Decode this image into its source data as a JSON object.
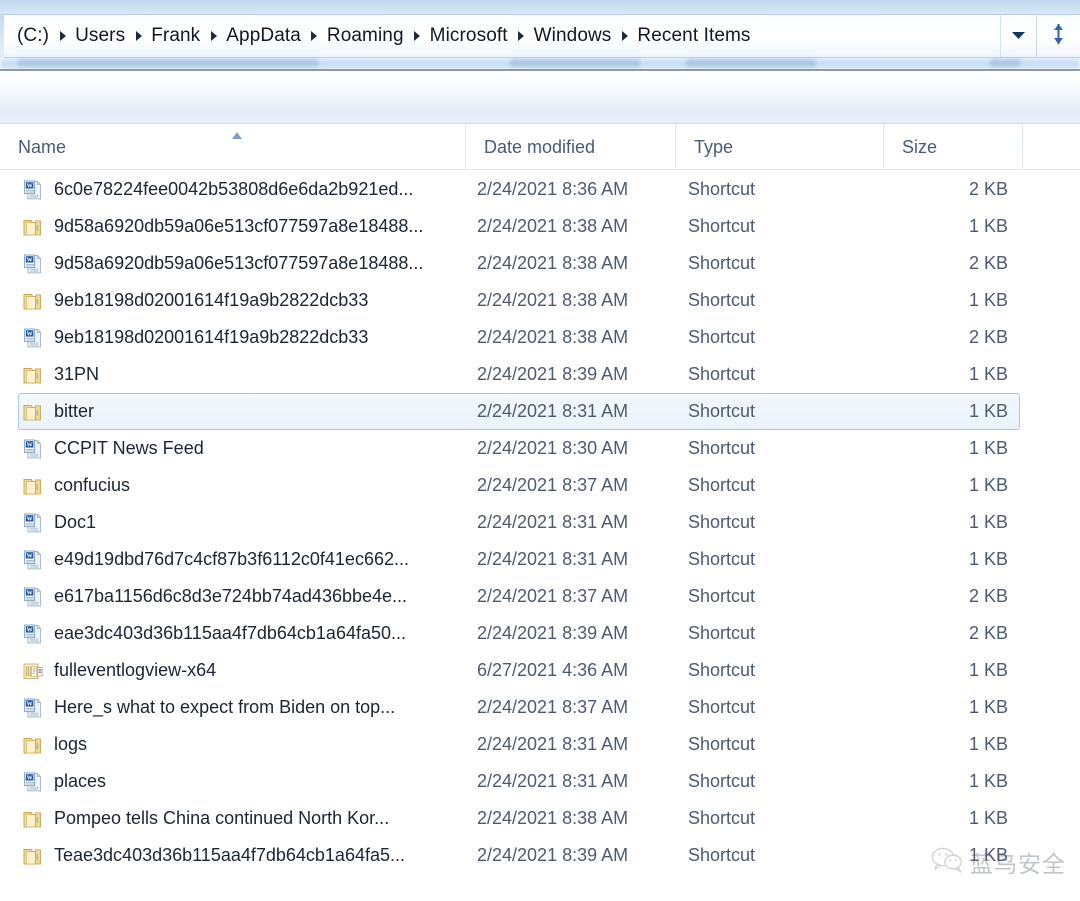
{
  "window": {
    "title": "Recent Items"
  },
  "address_bar": {
    "crumbs": [
      "(C:)",
      "Users",
      "Frank",
      "AppData",
      "Roaming",
      "Microsoft",
      "Windows",
      "Recent Items"
    ],
    "dropdown_icon": "chevron-down-icon",
    "refresh_icon": "refresh-icon",
    "refresh_color": "#1f5fa8"
  },
  "columns": {
    "name": "Name",
    "date_modified": "Date modified",
    "type": "Type",
    "size": "Size",
    "sort_column": "Name",
    "sort_direction": "ascending"
  },
  "files": [
    {
      "name": "6c0e78224fee0042b53808d6e6da2b921ed...",
      "icon": "word-document-icon",
      "date": "2/24/2021 8:36 AM",
      "type": "Shortcut",
      "size": "2 KB",
      "selected": false
    },
    {
      "name": "9d58a6920db59a06e513cf077597a8e18488...",
      "icon": "folder-icon",
      "date": "2/24/2021 8:38 AM",
      "type": "Shortcut",
      "size": "1 KB",
      "selected": false
    },
    {
      "name": "9d58a6920db59a06e513cf077597a8e18488...",
      "icon": "word-document-icon",
      "date": "2/24/2021 8:38 AM",
      "type": "Shortcut",
      "size": "2 KB",
      "selected": false
    },
    {
      "name": "9eb18198d02001614f19a9b2822dcb33",
      "icon": "folder-icon",
      "date": "2/24/2021 8:38 AM",
      "type": "Shortcut",
      "size": "1 KB",
      "selected": false
    },
    {
      "name": "9eb18198d02001614f19a9b2822dcb33",
      "icon": "word-document-icon",
      "date": "2/24/2021 8:38 AM",
      "type": "Shortcut",
      "size": "2 KB",
      "selected": false
    },
    {
      "name": "31PN",
      "icon": "folder-icon",
      "date": "2/24/2021 8:39 AM",
      "type": "Shortcut",
      "size": "1 KB",
      "selected": false
    },
    {
      "name": "bitter",
      "icon": "folder-icon",
      "date": "2/24/2021 8:31 AM",
      "type": "Shortcut",
      "size": "1 KB",
      "selected": true
    },
    {
      "name": "CCPIT News Feed",
      "icon": "word-document-icon",
      "date": "2/24/2021 8:30 AM",
      "type": "Shortcut",
      "size": "1 KB",
      "selected": false
    },
    {
      "name": "confucius",
      "icon": "folder-icon",
      "date": "2/24/2021 8:37 AM",
      "type": "Shortcut",
      "size": "1 KB",
      "selected": false
    },
    {
      "name": "Doc1",
      "icon": "word-document-icon",
      "date": "2/24/2021 8:31 AM",
      "type": "Shortcut",
      "size": "1 KB",
      "selected": false
    },
    {
      "name": "e49d19dbd76d7c4cf87b3f6112c0f41ec662...",
      "icon": "word-document-icon",
      "date": "2/24/2021 8:31 AM",
      "type": "Shortcut",
      "size": "1 KB",
      "selected": false
    },
    {
      "name": "e617ba1156d6c8d3e724bb74ad436bbe4e...",
      "icon": "word-document-icon",
      "date": "2/24/2021 8:37 AM",
      "type": "Shortcut",
      "size": "2 KB",
      "selected": false
    },
    {
      "name": "eae3dc403d36b115aa4f7db64cb1a64fa50...",
      "icon": "word-document-icon",
      "date": "2/24/2021 8:39 AM",
      "type": "Shortcut",
      "size": "2 KB",
      "selected": false
    },
    {
      "name": "fulleventlogview-x64",
      "icon": "application-icon",
      "date": "6/27/2021 4:36 AM",
      "type": "Shortcut",
      "size": "1 KB",
      "selected": false
    },
    {
      "name": "Here_s what to expect from Biden on top...",
      "icon": "word-document-icon",
      "date": "2/24/2021 8:37 AM",
      "type": "Shortcut",
      "size": "1 KB",
      "selected": false
    },
    {
      "name": "logs",
      "icon": "folder-icon",
      "date": "2/24/2021 8:31 AM",
      "type": "Shortcut",
      "size": "1 KB",
      "selected": false
    },
    {
      "name": "places",
      "icon": "word-document-icon",
      "date": "2/24/2021 8:31 AM",
      "type": "Shortcut",
      "size": "1 KB",
      "selected": false
    },
    {
      "name": "Pompeo tells China continued North Kor...",
      "icon": "folder-icon",
      "date": "2/24/2021 8:38 AM",
      "type": "Shortcut",
      "size": "1 KB",
      "selected": false
    },
    {
      "name": "Teae3dc403d36b115aa4f7db64cb1a64fa5...",
      "icon": "folder-icon",
      "date": "2/24/2021 8:39 AM",
      "type": "Shortcut",
      "size": "1 KB",
      "selected": false
    }
  ],
  "watermark": {
    "text": "蓝鸟安全",
    "icon": "wechat-icon"
  }
}
